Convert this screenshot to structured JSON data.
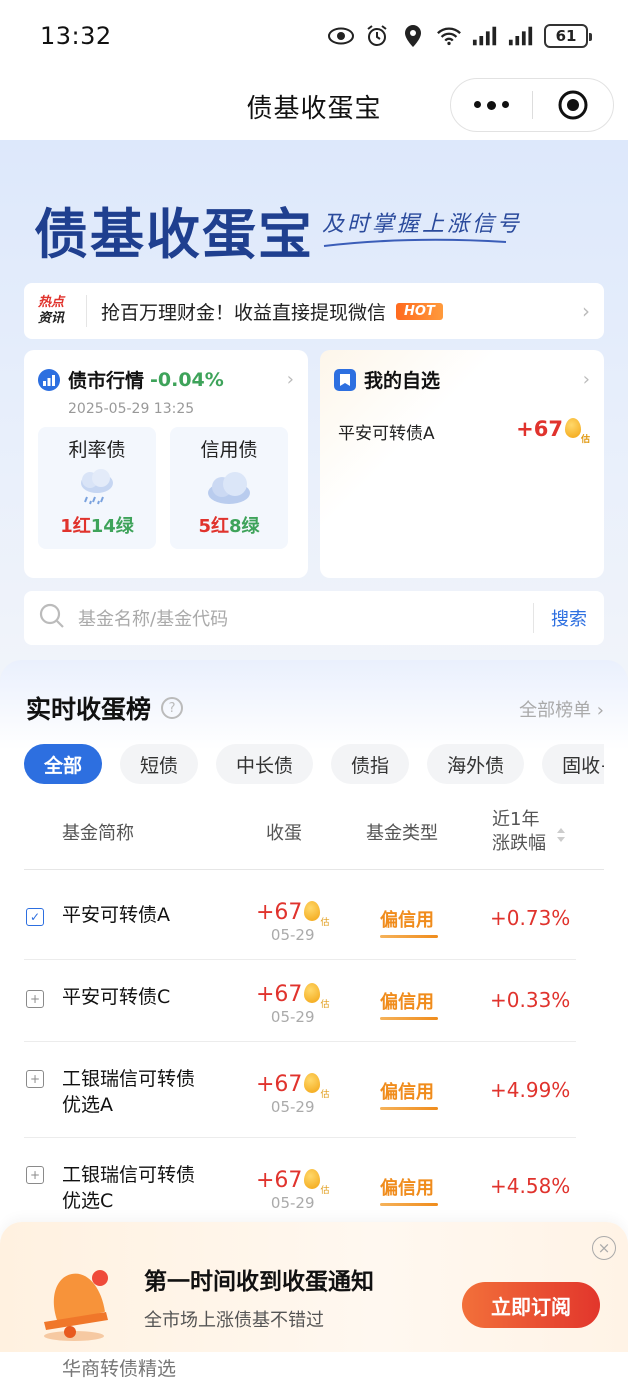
{
  "status_bar": {
    "time": "13:32",
    "battery": "61"
  },
  "nav": {
    "title": "债基收蛋宝"
  },
  "hero": {
    "logo_text": "债基收蛋宝",
    "slogan": "及时掌握上涨信号"
  },
  "news": {
    "tag_line1": "热点",
    "tag_line2": "资讯",
    "text": "抢百万理财金！收益直接提现微信",
    "badge": "HOT"
  },
  "market_card": {
    "title": "债市行情",
    "change": "-0.04%",
    "time": "2025-05-29 13:25",
    "boxes": [
      {
        "name": "利率债",
        "red": "1红",
        "green": "14绿",
        "weather": "rain-cloud-icon"
      },
      {
        "name": "信用债",
        "red": "5红",
        "green": "8绿",
        "weather": "cloud-icon"
      }
    ]
  },
  "fav_card": {
    "title": "我的自选",
    "items": [
      {
        "name": "平安可转债A",
        "value": "+67",
        "est": "估"
      }
    ]
  },
  "search": {
    "placeholder": "基金名称/基金代码",
    "button": "搜索"
  },
  "ranking": {
    "title": "实时收蛋榜",
    "help": "?",
    "all_label": "全部榜单",
    "chips": [
      "全部",
      "短债",
      "中长债",
      "债指",
      "海外债",
      "固收+"
    ],
    "columns": {
      "name": "基金简称",
      "egg": "收蛋",
      "type": "基金类型",
      "change_line1": "近1年",
      "change_line2": "涨跌幅"
    },
    "rows": [
      {
        "name": "平安可转债A",
        "egg": "+67",
        "est": "估",
        "date": "05-29",
        "type": "偏信用",
        "change": "+0.73%",
        "checked": true
      },
      {
        "name": "平安可转债C",
        "egg": "+67",
        "est": "估",
        "date": "05-29",
        "type": "偏信用",
        "change": "+0.33%",
        "checked": false
      },
      {
        "name": "工银瑞信可转债优选A",
        "egg": "+67",
        "est": "估",
        "date": "05-29",
        "type": "偏信用",
        "change": "+4.99%",
        "checked": false
      },
      {
        "name": "工银瑞信可转债优选C",
        "egg": "+67",
        "est": "估",
        "date": "05-29",
        "type": "偏信用",
        "change": "+4.58%",
        "checked": false
      }
    ],
    "partial_row_name": "华商转债精选"
  },
  "banner": {
    "title": "第一时间收到收蛋通知",
    "subtitle": "全市场上涨债基不错过",
    "button": "立即订阅",
    "close": "×"
  },
  "colors": {
    "accent": "#2d6fe0",
    "up": "#e0332d",
    "down": "#3ea35a",
    "type": "#f08c1c"
  }
}
